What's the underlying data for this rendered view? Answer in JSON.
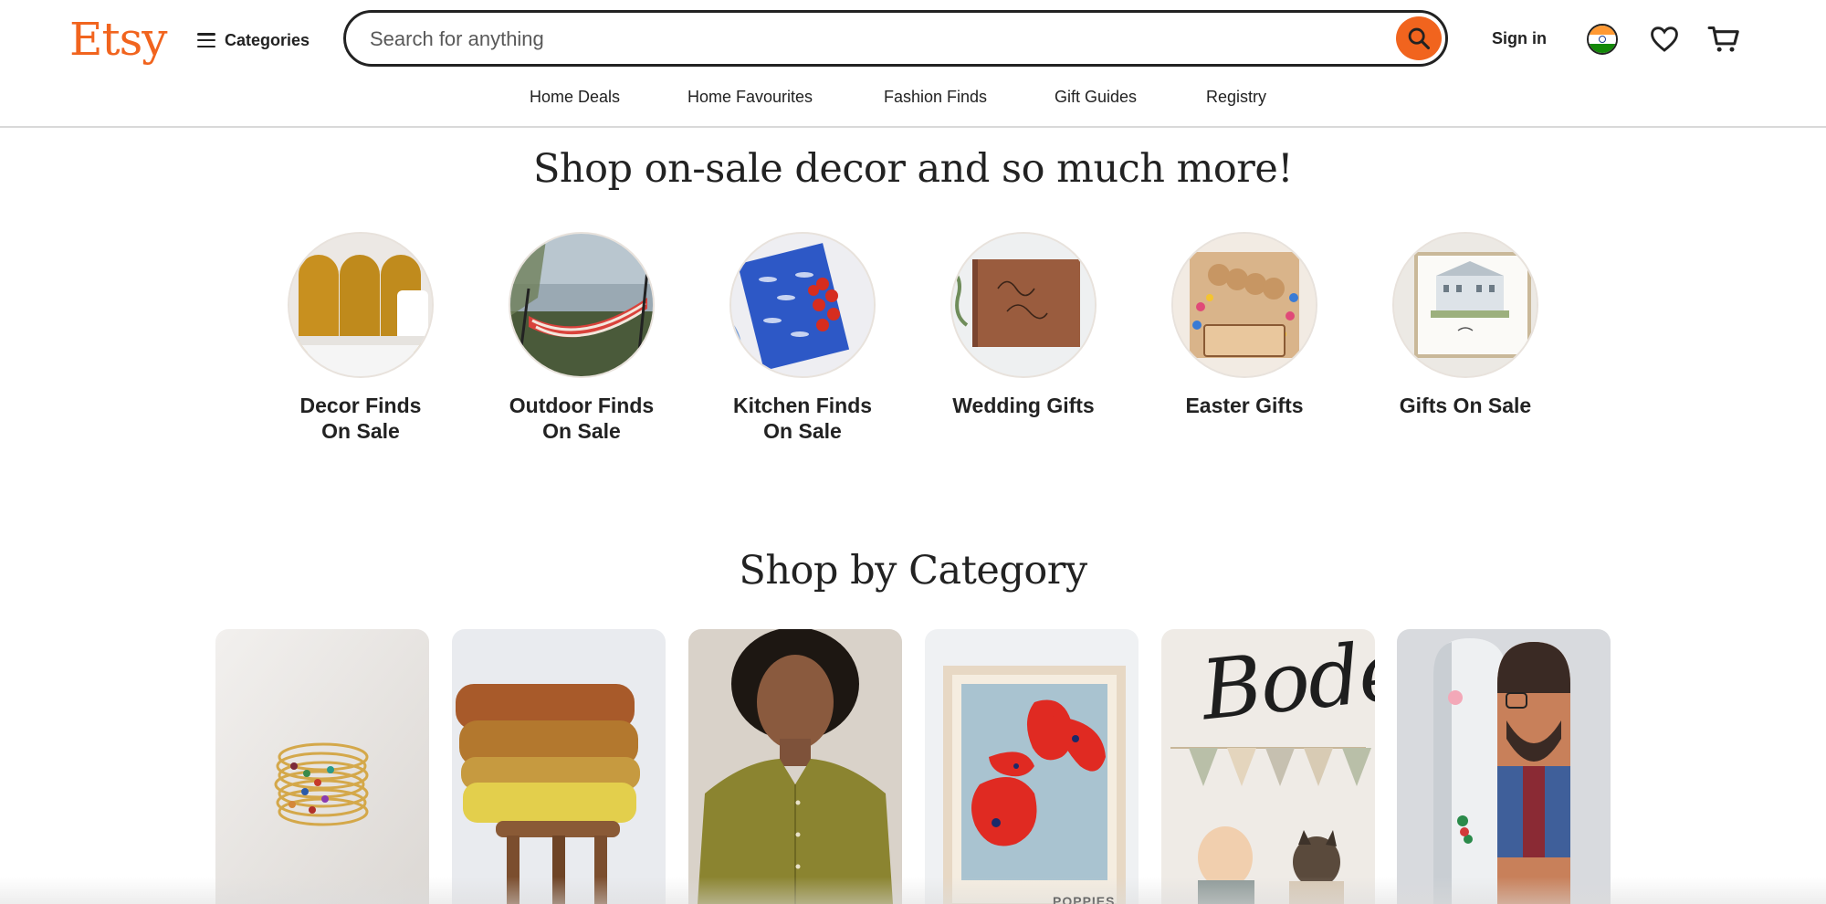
{
  "header": {
    "logo": "Etsy",
    "categories_label": "Categories",
    "search": {
      "placeholder": "Search for anything",
      "value": ""
    },
    "sign_in_label": "Sign in",
    "icons": {
      "search": "search-icon",
      "menu": "hamburger-icon",
      "flag": "india-flag-icon",
      "favorites": "heart-icon",
      "cart": "cart-icon"
    }
  },
  "subnav": {
    "items": [
      {
        "label": "Home Deals"
      },
      {
        "label": "Home Favourites"
      },
      {
        "label": "Fashion Finds"
      },
      {
        "label": "Gift Guides"
      },
      {
        "label": "Registry"
      }
    ]
  },
  "sale_section": {
    "title": "Shop on-sale decor and so much more!",
    "items": [
      {
        "line1": "Decor Finds",
        "line2": "On Sale"
      },
      {
        "line1": "Outdoor Finds",
        "line2": "On Sale"
      },
      {
        "line1": "Kitchen Finds",
        "line2": "On Sale"
      },
      {
        "line1": "Wedding Gifts",
        "line2": ""
      },
      {
        "line1": "Easter Gifts",
        "line2": ""
      },
      {
        "line1": "Gifts On Sale",
        "line2": ""
      }
    ]
  },
  "category_section": {
    "title": "Shop by Category",
    "tile_texts": {
      "signage_word": "Bode",
      "poster_word": "POPPIES"
    }
  },
  "colors": {
    "brand": "#F1641E",
    "text": "#222222"
  }
}
